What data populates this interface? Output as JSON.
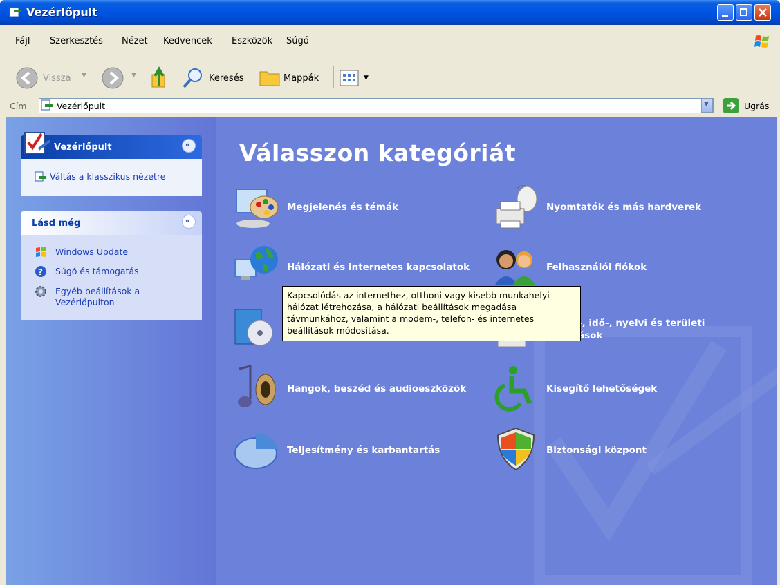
{
  "window": {
    "title": "Vezérlőpult"
  },
  "menu": [
    "Fájl",
    "Szerkesztés",
    "Nézet",
    "Kedvencek",
    "Eszközök",
    "Súgó"
  ],
  "toolbar": {
    "back": "Vissza",
    "search": "Keresés",
    "folders": "Mappák"
  },
  "address": {
    "label": "Cím",
    "value": "Vezérlőpult",
    "go": "Ugrás"
  },
  "left_pane": {
    "panel1": {
      "title": "Vezérlőpult",
      "link": "Váltás a klasszikus nézetre"
    },
    "panel2": {
      "title": "Lásd még",
      "links": [
        "Windows Update",
        "Súgó és támogatás",
        "Egyéb beállítások a",
        "Vezérlőpulton"
      ]
    }
  },
  "main": {
    "heading": "Válasszon kategóriát",
    "categories": [
      "Megjelenés és témák",
      "Nyomtatók és más hardverek",
      "Hálózati és internetes kapcsolatok",
      "Felhasználói fiókok",
      "-, idő-, nyelvi és területi",
      "ások",
      "Hangok, beszéd és audioeszközök",
      "Kisegítő lehetőségek",
      "Teljesítmény és karbantartás",
      "Biztonsági központ"
    ],
    "tooltip": [
      "Kapcsolódás az internethez, otthoni vagy kisebb munkahelyi",
      "hálózat létrehozása, a hálózati beállítások megadása",
      "távmunkához, valamint a modem-, telefon- és internetes",
      "beállítások módosítása."
    ]
  }
}
